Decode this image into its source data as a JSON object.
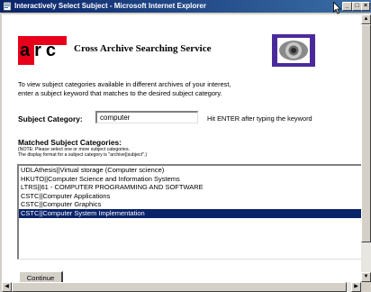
{
  "window": {
    "title": "Interactively Select Subject - Microsoft Internet Explorer",
    "minimize": "_",
    "maximize": "□",
    "close": "×"
  },
  "header": {
    "logo_text": "arc",
    "page_title": "Cross Archive Searching Service",
    "logo_color": "#e8001b"
  },
  "intro": {
    "line1": "To view subject categories available in different archives of your interest,",
    "line2": "enter a subject keyword that matches to the desired subject category."
  },
  "subject": {
    "label": "Subject Category:",
    "value": "computer",
    "hint": "Hit ENTER after typing the keyword"
  },
  "matched": {
    "heading": "Matched Subject Categories:",
    "note1": "(NOTE: Please select one or more subject categories.",
    "note2": "The display format for a subject category is \"archive||subject\".)",
    "items": [
      {
        "label": "UDLAthesis||Virtual storage (Computer science)",
        "selected": false
      },
      {
        "label": "HKUTO||Computer Science and Information Systems",
        "selected": false
      },
      {
        "label": "LTRS||61 - COMPUTER PROGRAMMING AND SOFTWARE",
        "selected": false
      },
      {
        "label": "CSTC||Computer Applications",
        "selected": false
      },
      {
        "label": "CSTC||Computer Graphics",
        "selected": false
      },
      {
        "label": "CSTC||Computer System Implementation",
        "selected": true
      }
    ]
  },
  "actions": {
    "continue_label": "Continue"
  },
  "scrollbars": {
    "up": "▲",
    "down": "▼",
    "left": "◀",
    "right": "▶"
  },
  "colors": {
    "titlebar": "#0a246a",
    "selection": "#0a246a"
  }
}
